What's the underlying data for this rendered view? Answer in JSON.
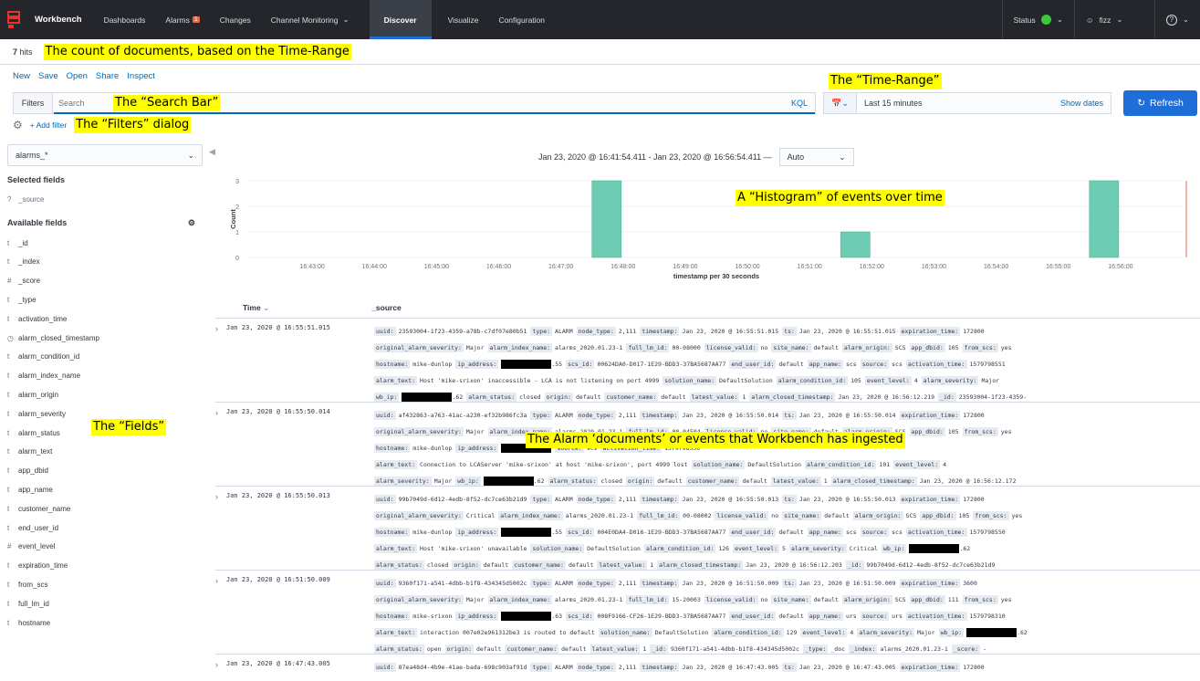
{
  "nav": {
    "brand": "Workbench",
    "items": [
      "Dashboards",
      "Alarms",
      "Changes",
      "Channel Monitoring",
      "Discover",
      "Visualize",
      "Configuration"
    ],
    "alarms_badge": "1",
    "active": "Discover",
    "status_label": "Status",
    "user": "fizz",
    "help_icon": "help-icon"
  },
  "hits": {
    "count": "7",
    "label": "hits"
  },
  "annotations": {
    "count": "The count of documents, based on the Time-Range",
    "timerange": "The “Time-Range”",
    "search": "The “Search Bar”",
    "filters": "The “Filters” dialog",
    "histogram": "A “Histogram” of events over time",
    "fields": "The “Fields”",
    "documents": "The Alarm ‘documents’ or events that Workbench has ingested"
  },
  "actions": [
    "New",
    "Save",
    "Open",
    "Share",
    "Inspect"
  ],
  "query": {
    "filters_label": "Filters",
    "placeholder": "Search",
    "kql": "KQL",
    "time_value": "Last 15 minutes",
    "show_dates": "Show dates",
    "refresh": "Refresh",
    "add_filter": "+ Add filter"
  },
  "sidebar": {
    "index_pattern": "alarms_*",
    "selected_title": "Selected fields",
    "selected": [
      {
        "type": "?",
        "name": "_source"
      }
    ],
    "available_title": "Available fields",
    "available": [
      {
        "type": "t",
        "name": "_id"
      },
      {
        "type": "t",
        "name": "_index"
      },
      {
        "type": "#",
        "name": "_score"
      },
      {
        "type": "t",
        "name": "_type"
      },
      {
        "type": "t",
        "name": "activation_time"
      },
      {
        "type": "◷",
        "name": "alarm_closed_timestamp"
      },
      {
        "type": "t",
        "name": "alarm_condition_id"
      },
      {
        "type": "t",
        "name": "alarm_index_name"
      },
      {
        "type": "t",
        "name": "alarm_origin"
      },
      {
        "type": "t",
        "name": "alarm_severity"
      },
      {
        "type": "t",
        "name": "alarm_status"
      },
      {
        "type": "t",
        "name": "alarm_text"
      },
      {
        "type": "t",
        "name": "app_dbid"
      },
      {
        "type": "t",
        "name": "app_name"
      },
      {
        "type": "t",
        "name": "customer_name"
      },
      {
        "type": "t",
        "name": "end_user_id"
      },
      {
        "type": "#",
        "name": "event_level"
      },
      {
        "type": "t",
        "name": "expiration_time"
      },
      {
        "type": "t",
        "name": "from_scs"
      },
      {
        "type": "t",
        "name": "full_lm_id"
      },
      {
        "type": "t",
        "name": "hostname"
      }
    ]
  },
  "histogram": {
    "date_range": "Jan 23, 2020 @ 16:41:54.411 - Jan 23, 2020 @ 16:56:54.411 —",
    "interval": "Auto"
  },
  "chart_data": {
    "type": "bar",
    "xlabel": "timestamp per 30 seconds",
    "ylabel": "Count",
    "ylim": [
      0,
      3
    ],
    "y_ticks": [
      "0",
      "1",
      "2",
      "3"
    ],
    "x_ticks": [
      "16:43:00",
      "16:44:00",
      "16:45:00",
      "16:46:00",
      "16:47:00",
      "16:48:00",
      "16:49:00",
      "16:50:00",
      "16:51:00",
      "16:52:00",
      "16:53:00",
      "16:54:00",
      "16:55:00",
      "16:56:00"
    ],
    "categories": [
      "16:47:30",
      "16:51:30",
      "16:55:30"
    ],
    "values": [
      3,
      1,
      3
    ],
    "bar_color": "#6dccb1"
  },
  "table": {
    "col_time": "Time",
    "col_source": "_source",
    "rows": [
      {
        "time": "Jan 23, 2020 @ 16:55:51.015",
        "lines": [
          [
            [
              "uuid:",
              "23593004-1f23-4359-a78b-c7df07e80b51"
            ],
            [
              "type:",
              "ALARM"
            ],
            [
              "node_type:",
              "2,111"
            ],
            [
              "timestamp:",
              "Jan 23, 2020 @ 16:55:51.015"
            ],
            [
              "ts:",
              "Jan 23, 2020 @ 16:55:51.015"
            ],
            [
              "expiration_time:",
              "172800"
            ]
          ],
          [
            [
              "original_alarm_severity:",
              "Major"
            ],
            [
              "alarm_index_name:",
              "alarms_2020.01.23-1"
            ],
            [
              "full_lm_id:",
              "00-08000"
            ],
            [
              "license_valid:",
              "no"
            ],
            [
              "site_name:",
              "default"
            ],
            [
              "alarm_origin:",
              "SCS"
            ],
            [
              "app_dbid:",
              "105"
            ],
            [
              "from_scs:",
              "yes"
            ]
          ],
          [
            [
              "hostname:",
              "mike-dunlop"
            ],
            [
              "ip_address:",
              "█.55"
            ],
            [
              "scs_id:",
              "00624DA0-D017-1E29-BDD3-37BA5687AA77"
            ],
            [
              "end_user_id:",
              "default"
            ],
            [
              "app_name:",
              "scs"
            ],
            [
              "source:",
              "scs"
            ],
            [
              "activation_time:",
              "1579798551"
            ]
          ],
          [
            [
              "alarm_text:",
              "Host 'mike-srixon' inaccessible - LCA is not listening on port 4999"
            ],
            [
              "solution_name:",
              "DefaultSolution"
            ],
            [
              "alarm_condition_id:",
              "105"
            ],
            [
              "event_level:",
              "4"
            ],
            [
              "alarm_severity:",
              "Major"
            ]
          ],
          [
            [
              "wb_ip:",
              "█.62"
            ],
            [
              "alarm_status:",
              "closed"
            ],
            [
              "origin:",
              "default"
            ],
            [
              "customer_name:",
              "default"
            ],
            [
              "latest_value:",
              "1"
            ],
            [
              "alarm_closed_timestamp:",
              "Jan 23, 2020 @ 16:56:12.219"
            ],
            [
              "_id:",
              "23593004-1f23-4359-"
            ]
          ]
        ]
      },
      {
        "time": "Jan 23, 2020 @ 16:55:50.014",
        "lines": [
          [
            [
              "uuid:",
              "af432863-a763-41ac-a230-ef32b986fc3a"
            ],
            [
              "type:",
              "ALARM"
            ],
            [
              "node_type:",
              "2,111"
            ],
            [
              "timestamp:",
              "Jan 23, 2020 @ 16:55:50.014"
            ],
            [
              "ts:",
              "Jan 23, 2020 @ 16:55:50.014"
            ],
            [
              "expiration_time:",
              "172800"
            ]
          ],
          [
            [
              "original_alarm_severity:",
              "Major"
            ],
            [
              "alarm_index_name:",
              "alarms_2020.01.23-1"
            ],
            [
              "full_lm_id:",
              "00-04504"
            ],
            [
              "license_valid:",
              "no"
            ],
            [
              "site_name:",
              "default"
            ],
            [
              "alarm_origin:",
              "SCS"
            ],
            [
              "app_dbid:",
              "105"
            ],
            [
              "from_scs:",
              "yes"
            ]
          ],
          [
            [
              "hostname:",
              "mike-dunlop"
            ],
            [
              "ip_address:",
              "█"
            ],
            [
              "source:",
              "scs"
            ],
            [
              "activation_time:",
              "1579798550"
            ]
          ],
          [
            [
              "alarm_text:",
              "Connection to LCAServer 'mike-srixon' at host 'mike-srixon', port 4999 lost"
            ],
            [
              "solution_name:",
              "DefaultSolution"
            ],
            [
              "alarm_condition_id:",
              "101"
            ],
            [
              "event_level:",
              "4"
            ]
          ],
          [
            [
              "alarm_severity:",
              "Major"
            ],
            [
              "wb_ip:",
              "█.62"
            ],
            [
              "alarm_status:",
              "closed"
            ],
            [
              "origin:",
              "default"
            ],
            [
              "customer_name:",
              "default"
            ],
            [
              "latest_value:",
              "1"
            ],
            [
              "alarm_closed_timestamp:",
              "Jan 23, 2020 @ 16:56:12.172"
            ]
          ]
        ]
      },
      {
        "time": "Jan 23, 2020 @ 16:55:50.013",
        "lines": [
          [
            [
              "uuid:",
              "99b7049d-6d12-4edb-8f52-dc7ce63b21d9"
            ],
            [
              "type:",
              "ALARM"
            ],
            [
              "node_type:",
              "2,111"
            ],
            [
              "timestamp:",
              "Jan 23, 2020 @ 16:55:50.013"
            ],
            [
              "ts:",
              "Jan 23, 2020 @ 16:55:50.013"
            ],
            [
              "expiration_time:",
              "172800"
            ]
          ],
          [
            [
              "original_alarm_severity:",
              "Critical"
            ],
            [
              "alarm_index_name:",
              "alarms_2020.01.23-1"
            ],
            [
              "full_lm_id:",
              "00-08002"
            ],
            [
              "license_valid:",
              "no"
            ],
            [
              "site_name:",
              "default"
            ],
            [
              "alarm_origin:",
              "SCS"
            ],
            [
              "app_dbid:",
              "105"
            ],
            [
              "from_scs:",
              "yes"
            ]
          ],
          [
            [
              "hostname:",
              "mike-dunlop"
            ],
            [
              "ip_address:",
              "█.55"
            ],
            [
              "scs_id:",
              "004E0DA4-D016-1E29-BDD3-37BA5687AA77"
            ],
            [
              "end_user_id:",
              "default"
            ],
            [
              "app_name:",
              "scs"
            ],
            [
              "source:",
              "scs"
            ],
            [
              "activation_time:",
              "1579798550"
            ]
          ],
          [
            [
              "alarm_text:",
              "Host 'mike-srixon' unavailable"
            ],
            [
              "solution_name:",
              "DefaultSolution"
            ],
            [
              "alarm_condition_id:",
              "126"
            ],
            [
              "event_level:",
              "5"
            ],
            [
              "alarm_severity:",
              "Critical"
            ],
            [
              "wb_ip:",
              "█.62"
            ]
          ],
          [
            [
              "alarm_status:",
              "closed"
            ],
            [
              "origin:",
              "default"
            ],
            [
              "customer_name:",
              "default"
            ],
            [
              "latest_value:",
              "1"
            ],
            [
              "alarm_closed_timestamp:",
              "Jan 23, 2020 @ 16:56:12.203"
            ],
            [
              "_id:",
              "99b7049d-6d12-4edb-8f52-dc7ce63b21d9"
            ]
          ]
        ]
      },
      {
        "time": "Jan 23, 2020 @ 16:51:50.009",
        "lines": [
          [
            [
              "uuid:",
              "9360f171-a541-4dbb-b1f8-434345d5002c"
            ],
            [
              "type:",
              "ALARM"
            ],
            [
              "node_type:",
              "2,111"
            ],
            [
              "timestamp:",
              "Jan 23, 2020 @ 16:51:50.009"
            ],
            [
              "ts:",
              "Jan 23, 2020 @ 16:51:50.009"
            ],
            [
              "expiration_time:",
              "3600"
            ]
          ],
          [
            [
              "original_alarm_severity:",
              "Major"
            ],
            [
              "alarm_index_name:",
              "alarms_2020.01.23-1"
            ],
            [
              "full_lm_id:",
              "15-20003"
            ],
            [
              "license_valid:",
              "no"
            ],
            [
              "site_name:",
              "default"
            ],
            [
              "alarm_origin:",
              "SCS"
            ],
            [
              "app_dbid:",
              "111"
            ],
            [
              "from_scs:",
              "yes"
            ]
          ],
          [
            [
              "hostname:",
              "mike-srixon"
            ],
            [
              "ip_address:",
              "█.63"
            ],
            [
              "scs_id:",
              "008F9166-CF26-1E29-BDD3-37BA5687AA77"
            ],
            [
              "end_user_id:",
              "default"
            ],
            [
              "app_name:",
              "urs"
            ],
            [
              "source:",
              "urs"
            ],
            [
              "activation_time:",
              "1579798310"
            ]
          ],
          [
            [
              "alarm_text:",
              "interaction 007e02e961312be3 is routed to default"
            ],
            [
              "solution_name:",
              "DefaultSolution"
            ],
            [
              "alarm_condition_id:",
              "129"
            ],
            [
              "event_level:",
              "4"
            ],
            [
              "alarm_severity:",
              "Major"
            ],
            [
              "wb_ip:",
              "█.62"
            ]
          ],
          [
            [
              "alarm_status:",
              "open"
            ],
            [
              "origin:",
              "default"
            ],
            [
              "customer_name:",
              "default"
            ],
            [
              "latest_value:",
              "1"
            ],
            [
              "_id:",
              "9360f171-a541-4dbb-b1f8-434345d5002c"
            ],
            [
              "_type:",
              "_doc"
            ],
            [
              "_index:",
              "alarms_2020.01.23-1"
            ],
            [
              "_score:",
              "-"
            ]
          ]
        ]
      },
      {
        "time": "Jan 23, 2020 @ 16:47:43.005",
        "lines": [
          [
            [
              "uuid:",
              "87ea48d4-4b9e-41ae-bada-698c903af91d"
            ],
            [
              "type:",
              "ALARM"
            ],
            [
              "node_type:",
              "2,111"
            ],
            [
              "timestamp:",
              "Jan 23, 2020 @ 16:47:43.005"
            ],
            [
              "ts:",
              "Jan 23, 2020 @ 16:47:43.005"
            ],
            [
              "expiration_time:",
              "172800"
            ]
          ]
        ]
      }
    ]
  }
}
